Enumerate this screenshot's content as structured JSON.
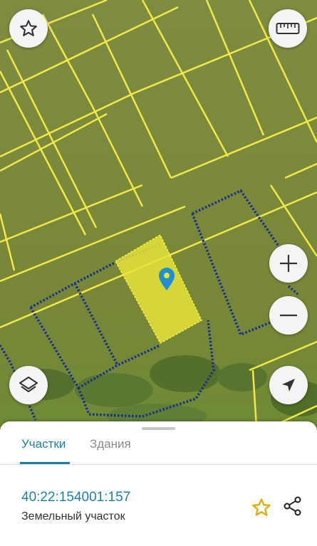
{
  "map": {
    "imagery_color": "#7c8a3e",
    "boundary_color": "#f2e84a",
    "selected_parcel_color": "#e6e33a",
    "dotted_boundary_color": "#1a2f8a",
    "marker_color": "#1e8fd0"
  },
  "controls": {
    "favorite": "star-icon",
    "ruler": "ruler-icon",
    "zoom_in": "plus-icon",
    "zoom_out": "minus-icon",
    "layers": "layers-icon",
    "locate": "navigation-arrow-icon"
  },
  "tabs": [
    {
      "label": "Участки",
      "active": true
    },
    {
      "label": "Здания",
      "active": false
    }
  ],
  "parcel": {
    "cadastral_number": "40:22:154001:157",
    "type": "Земельный участок"
  },
  "colors": {
    "accent": "#1f7fa8",
    "star_outline": "#d9b21c"
  }
}
